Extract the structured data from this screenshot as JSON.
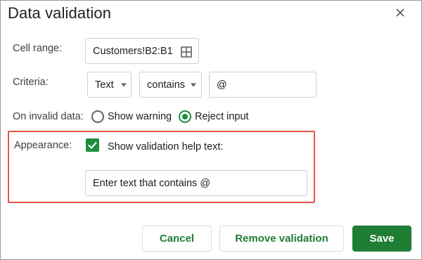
{
  "dialog": {
    "title": "Data validation"
  },
  "cell_range": {
    "label": "Cell range:",
    "value": "Customers!B2:B1",
    "icon": "grid-icon"
  },
  "criteria": {
    "label": "Criteria:",
    "type_value": "Text",
    "condition_value": "contains",
    "text_value": "@"
  },
  "invalid_data": {
    "label": "On invalid data:",
    "options": [
      "Show warning",
      "Reject input"
    ],
    "selected": "Reject input"
  },
  "appearance": {
    "label": "Appearance:",
    "checkbox_label": "Show validation help text:",
    "checked": true,
    "help_text_value": "Enter text that contains @"
  },
  "buttons": {
    "cancel": "Cancel",
    "remove": "Remove validation",
    "save": "Save"
  },
  "colors": {
    "accent": "#1e7e34",
    "highlight": "#e8534b"
  }
}
